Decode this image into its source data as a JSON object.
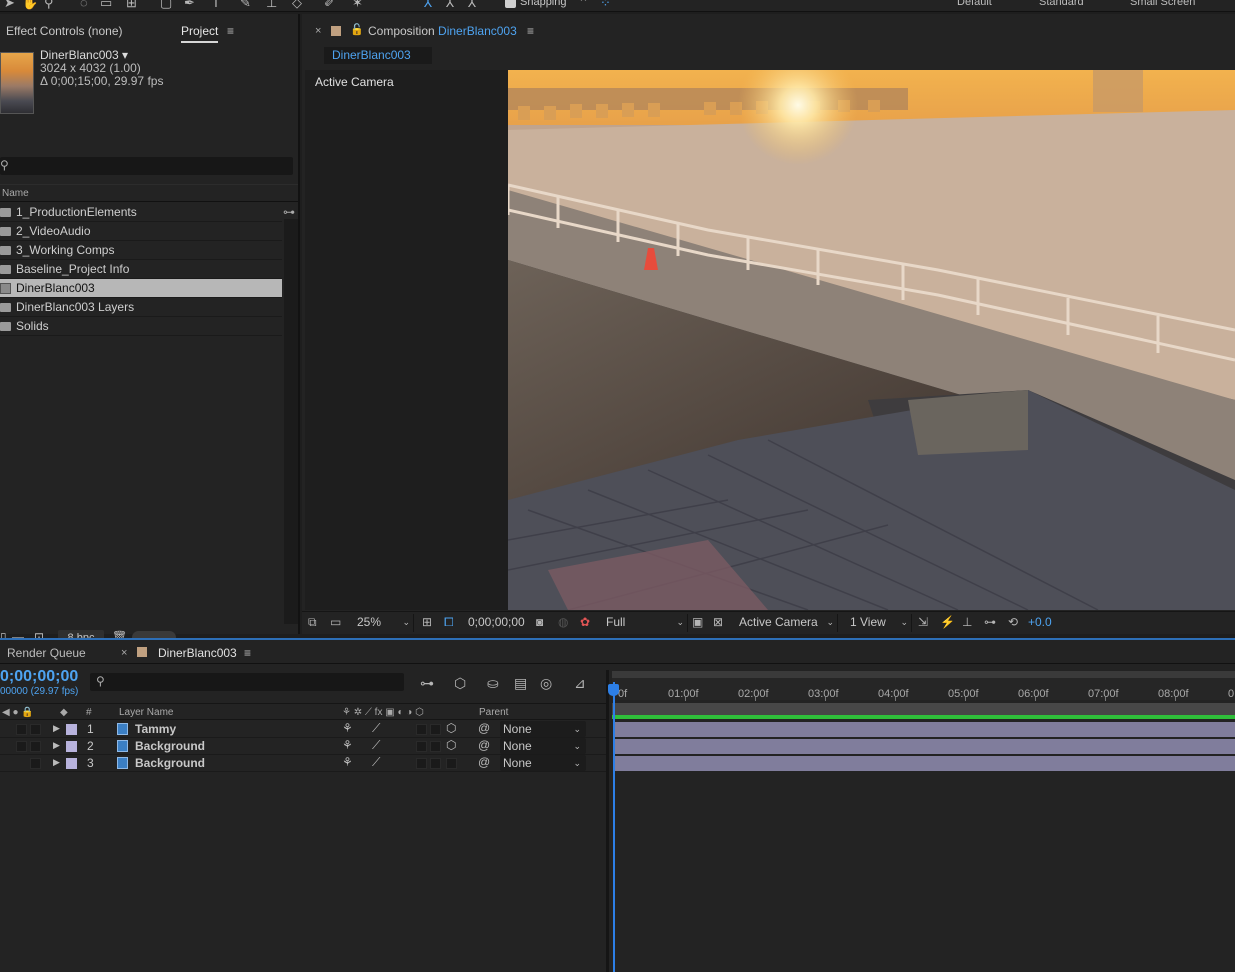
{
  "toolbar": {
    "snapping_label": "Snapping",
    "workspaces": [
      "Default",
      "Standard",
      "Small Screen"
    ]
  },
  "project_panel": {
    "effect_controls_tab": "Effect Controls (none)",
    "project_tab": "Project",
    "comp_name": "DinerBlanc003 ▾",
    "comp_dims": "3024 x 4032 (1.00)",
    "comp_duration": "Δ 0;00;15;00, 29.97 fps",
    "column_name": "Name",
    "items": [
      {
        "label": "1_ProductionElements",
        "type": "folder",
        "selected": false
      },
      {
        "label": "2_VideoAudio",
        "type": "folder",
        "selected": false
      },
      {
        "label": "3_Working Comps",
        "type": "folder",
        "selected": false
      },
      {
        "label": "Baseline_Project Info",
        "type": "folder",
        "selected": false
      },
      {
        "label": "DinerBlanc003",
        "type": "composition",
        "selected": true
      },
      {
        "label": "DinerBlanc003 Layers",
        "type": "folder",
        "selected": false
      },
      {
        "label": "Solids",
        "type": "folder",
        "selected": false
      }
    ],
    "bpc_label": "8 bpc"
  },
  "composition_panel": {
    "tab_prefix": "Composition",
    "tab_comp_name": "DinerBlanc003",
    "subtab": "DinerBlanc003",
    "active_camera_label": "Active Camera",
    "zoom": "25%",
    "timecode": "0;00;00;00",
    "resolution": "Full",
    "camera": "Active Camera",
    "views": "1 View",
    "exposure": "+0.0"
  },
  "timeline": {
    "render_queue_tab": "Render Queue",
    "comp_tab": "DinerBlanc003",
    "current_time": "0;00;00;00",
    "fps_label": "00000 (29.97 fps)",
    "columns": {
      "number": "#",
      "layer_name": "Layer Name",
      "parent": "Parent"
    },
    "ruler_labels": [
      "0f",
      "01:00f",
      "02:00f",
      "03:00f",
      "04:00f",
      "05:00f",
      "06:00f",
      "07:00f",
      "08:00f",
      "0"
    ],
    "layers": [
      {
        "number": "1",
        "name": "Tammy",
        "parent": "None"
      },
      {
        "number": "2",
        "name": "Background",
        "parent": "None"
      },
      {
        "number": "3",
        "name": "Background",
        "parent": "None"
      }
    ]
  },
  "colors": {
    "accent_blue": "#4ea3f0",
    "label_lavender": "#b8b3dd",
    "layer_bar": "#807d9c",
    "work_area_green": "#2fbf3a"
  }
}
